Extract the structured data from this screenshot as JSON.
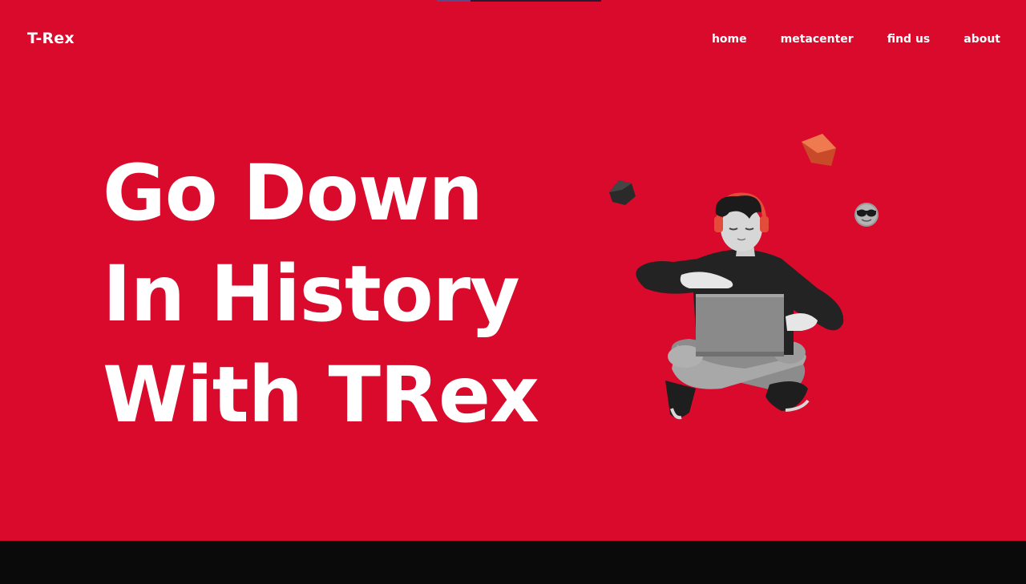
{
  "brand": {
    "logo_text": "T-Rex"
  },
  "nav": {
    "items": [
      {
        "label": "home"
      },
      {
        "label": "metacenter"
      },
      {
        "label": "find us"
      },
      {
        "label": "about"
      }
    ]
  },
  "hero": {
    "headline_lines": [
      "Go Down",
      "In History",
      "With TRex"
    ]
  },
  "colors": {
    "hero_background": "#d90a2c",
    "footer_background": "#0a0a0a",
    "text": "#ffffff"
  },
  "illustration": {
    "icons": [
      "person-with-laptop-illustration",
      "orange-cube-icon",
      "dark-cube-icon",
      "sunglasses-emoji-icon"
    ]
  }
}
